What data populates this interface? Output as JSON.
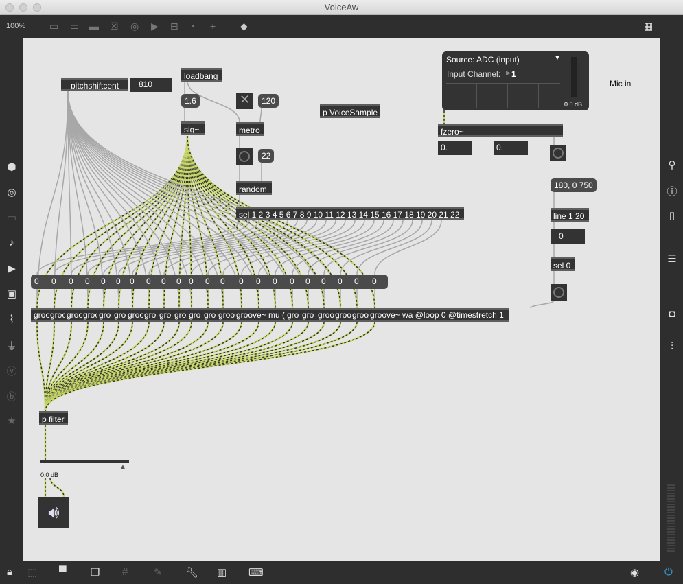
{
  "window": {
    "title": "VoiceAw",
    "zoom": "100%"
  },
  "objects": {
    "pitchshiftcent": "pitchshiftcent",
    "pitch_value": "810",
    "loadbang": "loadbang",
    "msg_16": "1.6",
    "sig": "sig~",
    "toggle": "✕",
    "num_120": "120",
    "metro": "metro",
    "num_22": "22",
    "random": "random",
    "sel": "sel 1 2 3 4 5 6 7 8 9 10 11 12 13 14 15 16 17 18 19 20 21 22",
    "voicesample": "p VoiceSample",
    "adc": {
      "source": "Source: ADC (input)",
      "channel_label": "Input Channel:",
      "channel": "1",
      "level": "0.0 dB"
    },
    "mic_in": "Mic in",
    "fzero": "fzero~",
    "fzero_out1": "0.",
    "fzero_out2": "0.",
    "msg_ramp": "180, 0 750",
    "line": "line 1 20",
    "line_num": "0",
    "sel0": "sel 0",
    "zeros": [
      "0",
      "0",
      "0",
      "0",
      "0",
      "0",
      "0",
      "0",
      "0",
      "0",
      "0",
      "0",
      "0",
      "0",
      "0",
      "0",
      "0",
      "0",
      "0",
      "0",
      "0",
      "0"
    ],
    "grooves": [
      "groo",
      "groo",
      "groo",
      "groo",
      "gro",
      "gro",
      "groo",
      "gro",
      "gro",
      "gro",
      "gro",
      "gro",
      "groo",
      "groove~ mu (",
      "gro",
      "gro",
      "groo",
      "groo",
      "groo",
      "groove~ wa @loop 0 @timestretch 1"
    ],
    "pfilter": "p filter",
    "gain_label": "0.0 dB"
  },
  "colors": {
    "canvas": "#e5e5e5",
    "signal_cord": "#c8d86a",
    "cord": "#a8a8a8"
  }
}
